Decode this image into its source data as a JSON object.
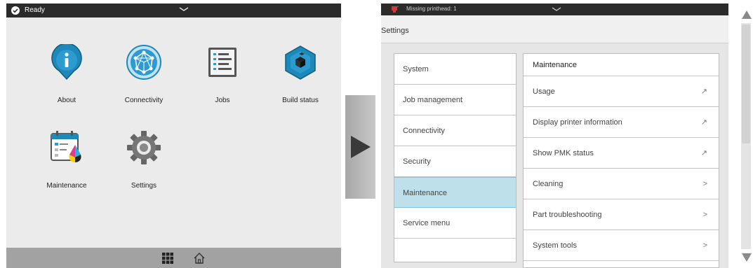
{
  "left_screen": {
    "status": {
      "text": "Ready",
      "icon": "check-circle-icon"
    },
    "apps": [
      {
        "label": "About",
        "icon": "info-pin-icon"
      },
      {
        "label": "Connectivity",
        "icon": "network-globe-icon"
      },
      {
        "label": "Jobs",
        "icon": "job-list-icon"
      },
      {
        "label": "Build status",
        "icon": "build-cubes-icon"
      },
      {
        "label": "Maintenance",
        "icon": "maintenance-calendar-icon"
      },
      {
        "label": "Settings",
        "icon": "gear-icon"
      }
    ],
    "bottom_bar": {
      "icons": [
        "grid-icon",
        "home-icon"
      ]
    }
  },
  "arrow": {
    "icon": "play-arrow-icon"
  },
  "right_screen": {
    "status": {
      "text": "Missing printhead: 1",
      "icon": "warning-printhead-icon"
    },
    "title": "Settings",
    "menu": [
      {
        "label": "System",
        "selected": false
      },
      {
        "label": "Job management",
        "selected": false
      },
      {
        "label": "Connectivity",
        "selected": false
      },
      {
        "label": "Security",
        "selected": false
      },
      {
        "label": "Maintenance",
        "selected": true
      },
      {
        "label": "Service menu",
        "selected": false
      }
    ],
    "detail": {
      "header": "Maintenance",
      "items": [
        {
          "label": "Usage",
          "arrow": "↗"
        },
        {
          "label": "Display printer information",
          "arrow": "↗"
        },
        {
          "label": "Show PMK status",
          "arrow": "↗"
        },
        {
          "label": "Cleaning",
          "arrow": ">"
        },
        {
          "label": "Part troubleshooting",
          "arrow": ">"
        },
        {
          "label": "System tools",
          "arrow": ">"
        }
      ]
    }
  },
  "colors": {
    "status_bar": "#2b2b2b",
    "selected_row": "#bde0ea",
    "icon_blue": "#1e88b8"
  }
}
